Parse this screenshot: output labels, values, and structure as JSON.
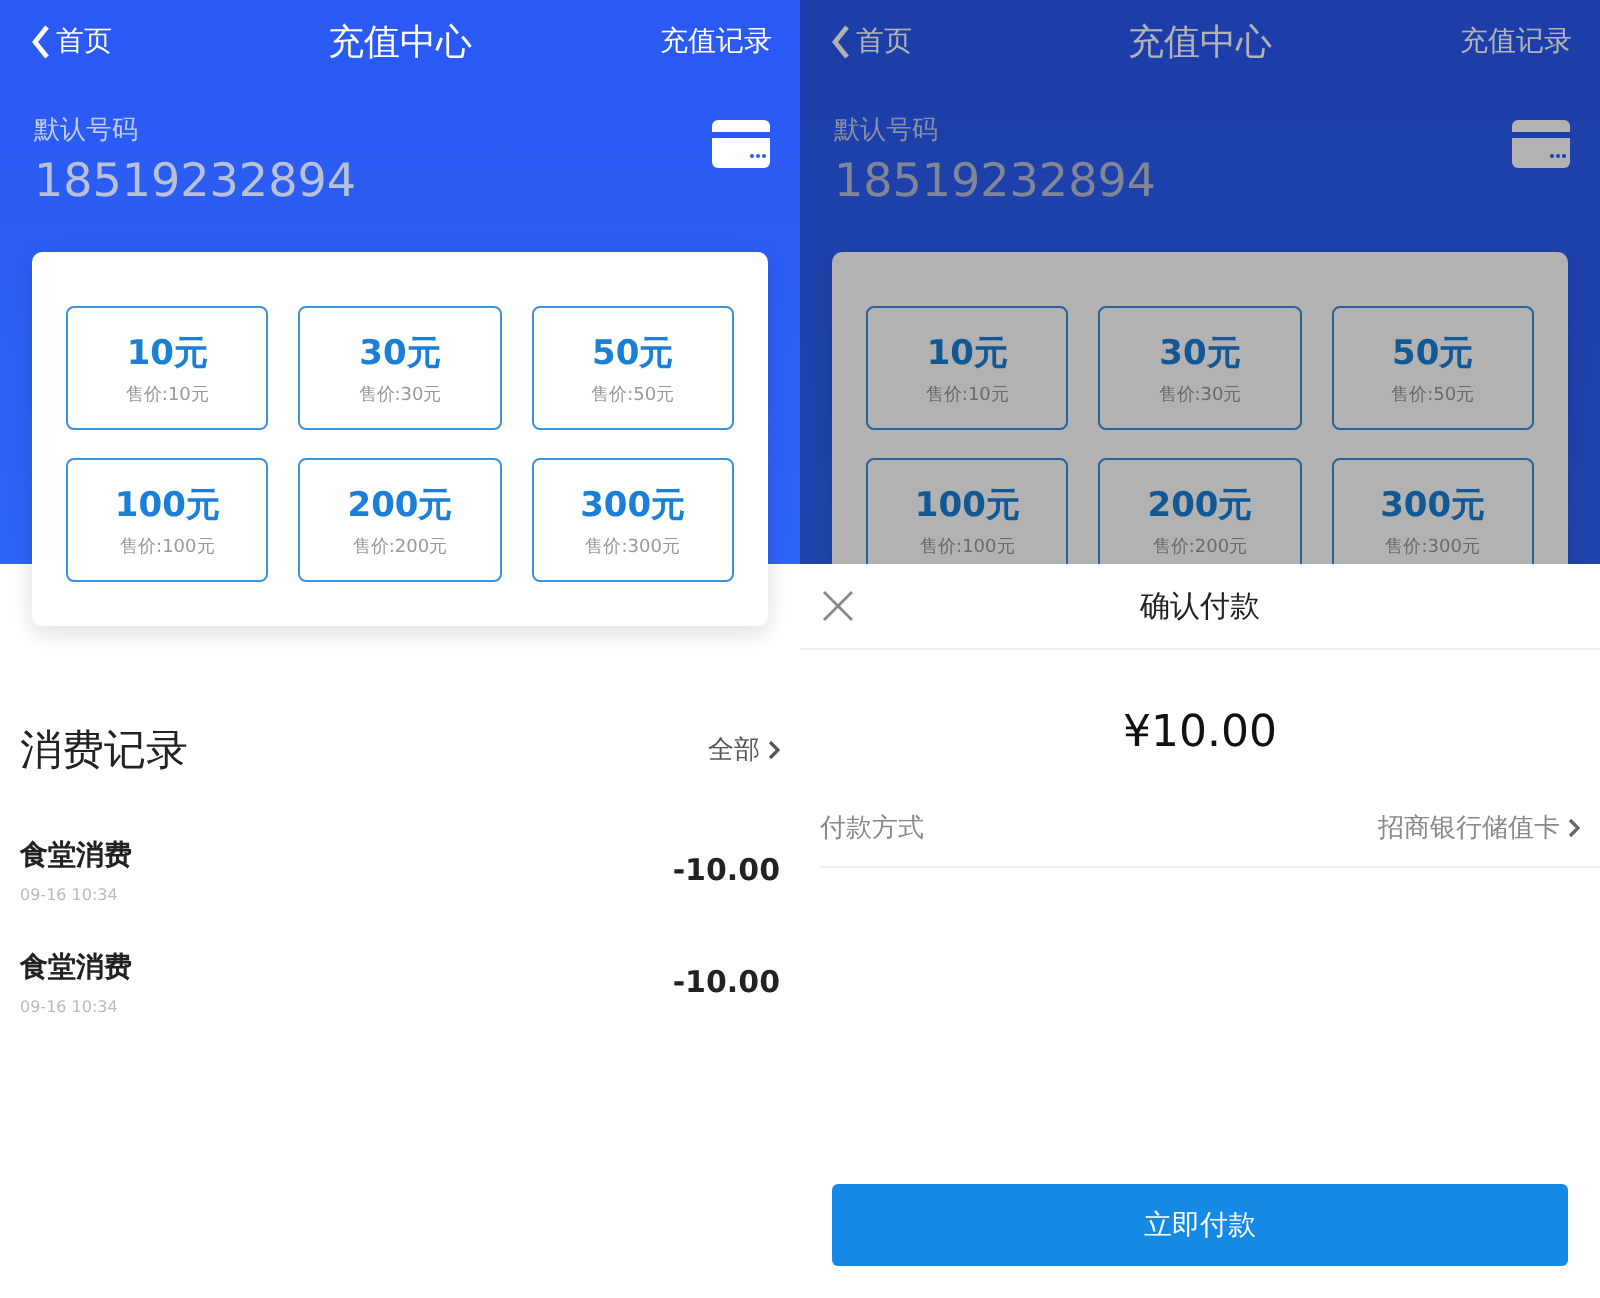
{
  "screens": [
    {
      "dimmed": false,
      "nav": {
        "back": "首页",
        "title": "充值中心",
        "action": "充值记录"
      },
      "account": {
        "label": "默认号码",
        "number": "18519232894"
      },
      "packages": [
        {
          "amount": "10元",
          "price": "售价:10元"
        },
        {
          "amount": "30元",
          "price": "售价:30元"
        },
        {
          "amount": "50元",
          "price": "售价:50元"
        },
        {
          "amount": "100元",
          "price": "售价:100元"
        },
        {
          "amount": "200元",
          "price": "售价:200元"
        },
        {
          "amount": "300元",
          "price": "售价:300元"
        }
      ],
      "records": {
        "title": "消费记录",
        "more": "全部",
        "items": [
          {
            "name": "食堂消费",
            "time": "09-16 10:34",
            "amount": "-10.00"
          },
          {
            "name": "食堂消费",
            "time": "09-16 10:34",
            "amount": "-10.00"
          }
        ]
      }
    },
    {
      "dimmed": true,
      "nav": {
        "back": "首页",
        "title": "充值中心",
        "action": "充值记录"
      },
      "account": {
        "label": "默认号码",
        "number": "18519232894"
      },
      "packages": [
        {
          "amount": "10元",
          "price": "售价:10元"
        },
        {
          "amount": "30元",
          "price": "售价:30元"
        },
        {
          "amount": "50元",
          "price": "售价:50元"
        },
        {
          "amount": "100元",
          "price": "售价:100元"
        },
        {
          "amount": "200元",
          "price": "售价:200元"
        },
        {
          "amount": "300元",
          "price": "售价:300元"
        }
      ],
      "sheet": {
        "title": "确认付款",
        "amount": "¥10.00",
        "method_label": "付款方式",
        "method_value": "招商银行储值卡",
        "button": "立即付款"
      }
    }
  ]
}
